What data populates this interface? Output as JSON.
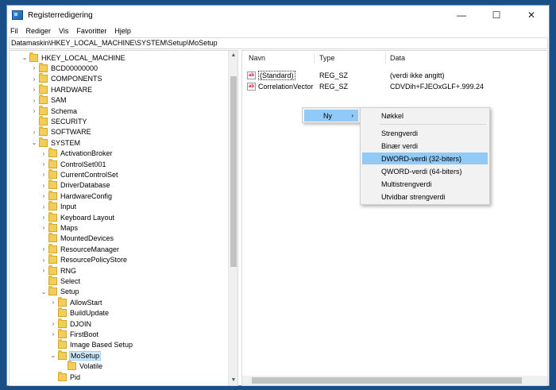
{
  "window": {
    "title": "Registerredigering",
    "minimize_glyph": "—",
    "maximize_glyph": "☐",
    "close_glyph": "✕"
  },
  "menu": {
    "items": [
      "Fil",
      "Rediger",
      "Vis",
      "Favoritter",
      "Hjelp"
    ]
  },
  "address": {
    "path": "Datamaskin\\HKEY_LOCAL_MACHINE\\SYSTEM\\Setup\\MoSetup"
  },
  "tree": {
    "items": [
      {
        "label": "HKEY_LOCAL_MACHINE",
        "expanded": true
      },
      {
        "label": "BCD00000000",
        "expanded": false
      },
      {
        "label": "COMPONENTS",
        "expanded": false
      },
      {
        "label": "HARDWARE",
        "expanded": false
      },
      {
        "label": "SAM",
        "expanded": false
      },
      {
        "label": "Schema",
        "expanded": false
      },
      {
        "label": "SECURITY",
        "expanded": null
      },
      {
        "label": "SOFTWARE",
        "expanded": false
      },
      {
        "label": "SYSTEM",
        "expanded": true
      },
      {
        "label": "ActivationBroker",
        "expanded": false
      },
      {
        "label": "ControlSet001",
        "expanded": false
      },
      {
        "label": "CurrentControlSet",
        "expanded": false
      },
      {
        "label": "DriverDatabase",
        "expanded": false
      },
      {
        "label": "HardwareConfig",
        "expanded": false
      },
      {
        "label": "Input",
        "expanded": false
      },
      {
        "label": "Keyboard Layout",
        "expanded": false
      },
      {
        "label": "Maps",
        "expanded": false
      },
      {
        "label": "MountedDevices",
        "expanded": null
      },
      {
        "label": "ResourceManager",
        "expanded": false
      },
      {
        "label": "ResourcePolicyStore",
        "expanded": false
      },
      {
        "label": "RNG",
        "expanded": false
      },
      {
        "label": "Select",
        "expanded": null
      },
      {
        "label": "Setup",
        "expanded": true
      },
      {
        "label": "AllowStart",
        "expanded": false
      },
      {
        "label": "BuildUpdate",
        "expanded": null
      },
      {
        "label": "DJOIN",
        "expanded": false
      },
      {
        "label": "FirstBoot",
        "expanded": false
      },
      {
        "label": "Image Based Setup",
        "expanded": null
      },
      {
        "label": "MoSetup",
        "expanded": true,
        "selected": true
      },
      {
        "label": "Volatile",
        "expanded": null
      },
      {
        "label": "Pid",
        "expanded": null
      }
    ]
  },
  "values_pane": {
    "headers": {
      "name": "Navn",
      "type": "Type",
      "data": "Data"
    },
    "rows": [
      {
        "name": "(Standard)",
        "type": "REG_SZ",
        "data": "(verdi ikke angitt)"
      },
      {
        "name": "CorrelationVector",
        "type": "REG_SZ",
        "data": "CDVDih+FJEOxGLF+.999.24"
      }
    ]
  },
  "context_menu": {
    "parent_label": "Ny",
    "parent_arrow": "›",
    "submenu": [
      {
        "label": "Nøkkel"
      },
      {
        "label": "Strengverdi"
      },
      {
        "label": "Binær verdi"
      },
      {
        "label": "DWORD-verdi (32-biters)",
        "highlighted": true
      },
      {
        "label": "QWORD-verdi (64-biters)"
      },
      {
        "label": "Multistrengverdi"
      },
      {
        "label": "Utvidbar strengverdi"
      }
    ]
  },
  "colors": {
    "selection": "#cce8ff",
    "menu_highlight": "#91c9f7",
    "desktop": "#1a4e86"
  }
}
